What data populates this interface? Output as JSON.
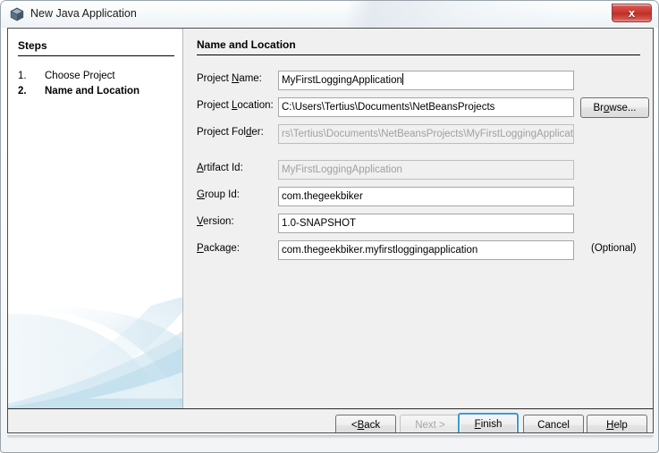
{
  "window": {
    "title": "New Java Application",
    "icon": "java-cube-icon",
    "close_label": "x",
    "colors": {
      "title_bar": "#f5f8fa",
      "panel_bg": "#f0f0f0",
      "steps_bg": "#ffffff",
      "close_red": "#c9352f",
      "default_button_focus": "#3c99d4",
      "swoosh_blue": "#bcd9e8"
    }
  },
  "steps": {
    "heading": "Steps",
    "items": [
      {
        "number": "1.",
        "label": "Choose Project",
        "current": false
      },
      {
        "number": "2.",
        "label": "Name and Location",
        "current": true
      }
    ]
  },
  "main": {
    "heading": "Name and Location",
    "fields": [
      {
        "name": "project-name",
        "label_pre": "Project ",
        "label_mn": "N",
        "label_post": "ame:",
        "value": "MyFirstLoggingApplication",
        "disabled": false,
        "caret": true
      },
      {
        "name": "project-location",
        "label_pre": "Project ",
        "label_mn": "L",
        "label_post": "ocation:",
        "value": "C:\\Users\\Tertius\\Documents\\NetBeansProjects",
        "disabled": false,
        "caret": false
      },
      {
        "name": "project-folder",
        "label_pre": "Project Fol",
        "label_mn": "d",
        "label_post": "er:",
        "value": "rs\\Tertius\\Documents\\NetBeansProjects\\MyFirstLoggingApplication",
        "disabled": true,
        "caret": false
      },
      {
        "name": "artifact-id",
        "label_pre": "",
        "label_mn": "A",
        "label_post": "rtifact Id:",
        "value": "MyFirstLoggingApplication",
        "disabled": true,
        "caret": false
      },
      {
        "name": "group-id",
        "label_pre": "",
        "label_mn": "G",
        "label_post": "roup Id:",
        "value": "com.thegeekbiker",
        "disabled": false,
        "caret": false
      },
      {
        "name": "version",
        "label_pre": "",
        "label_mn": "V",
        "label_post": "ersion:",
        "value": "1.0-SNAPSHOT",
        "disabled": false,
        "caret": false
      },
      {
        "name": "package",
        "label_pre": "",
        "label_mn": "P",
        "label_post": "ackage:",
        "value": "com.thegeekbiker.myfirstloggingapplication",
        "disabled": false,
        "caret": false
      }
    ],
    "browse_button": {
      "pre": "Br",
      "mn": "o",
      "post": "wse..."
    },
    "optional_label": "(Optional)"
  },
  "buttons": [
    {
      "name": "back",
      "pre": "< ",
      "mn": "B",
      "post": "ack",
      "disabled": false,
      "default": false
    },
    {
      "name": "next",
      "pre": "",
      "mn": "",
      "post": "Next >",
      "disabled": true,
      "default": false
    },
    {
      "name": "finish",
      "pre": "",
      "mn": "F",
      "post": "inish",
      "disabled": false,
      "default": true
    },
    {
      "name": "cancel",
      "pre": "",
      "mn": "",
      "post": "Cancel",
      "disabled": false,
      "default": false
    },
    {
      "name": "help",
      "pre": "",
      "mn": "H",
      "post": "elp",
      "disabled": false,
      "default": false
    }
  ]
}
